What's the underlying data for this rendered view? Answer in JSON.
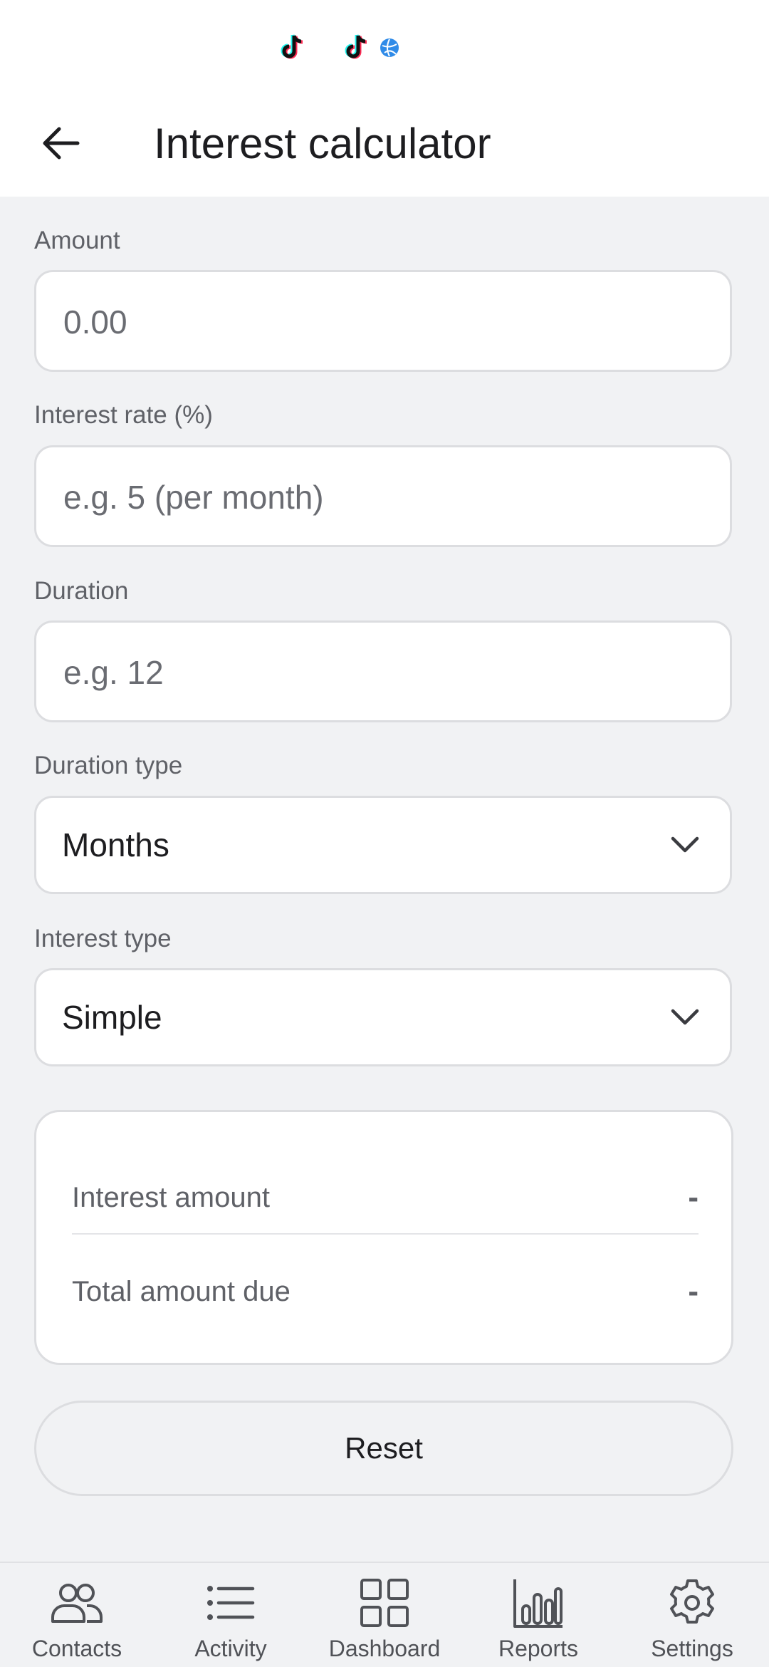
{
  "header": {
    "title": "Interest calculator"
  },
  "form": {
    "amount": {
      "label": "Amount",
      "placeholder": "0.00"
    },
    "interest_rate": {
      "label": "Interest rate (%)",
      "placeholder": "e.g. 5 (per month)"
    },
    "duration": {
      "label": "Duration",
      "placeholder": "e.g. 12"
    },
    "duration_type": {
      "label": "Duration type",
      "value": "Months"
    },
    "interest_type": {
      "label": "Interest type",
      "value": "Simple"
    }
  },
  "results": {
    "interest_amount": {
      "label": "Interest amount",
      "value": "-"
    },
    "total_amount_due": {
      "label": "Total amount due",
      "value": "-"
    }
  },
  "reset_label": "Reset",
  "nav": {
    "items": [
      {
        "label": "Contacts",
        "icon": "contacts-icon"
      },
      {
        "label": "Activity",
        "icon": "list-icon"
      },
      {
        "label": "Dashboard",
        "icon": "grid-icon"
      },
      {
        "label": "Reports",
        "icon": "bar-chart-icon"
      },
      {
        "label": "Settings",
        "icon": "gear-icon"
      }
    ]
  },
  "colors": {
    "background": "#f1f2f4",
    "surface": "#ffffff",
    "text_primary": "#1d1d20",
    "text_secondary": "#5f6167",
    "border": "#dcdde0"
  }
}
